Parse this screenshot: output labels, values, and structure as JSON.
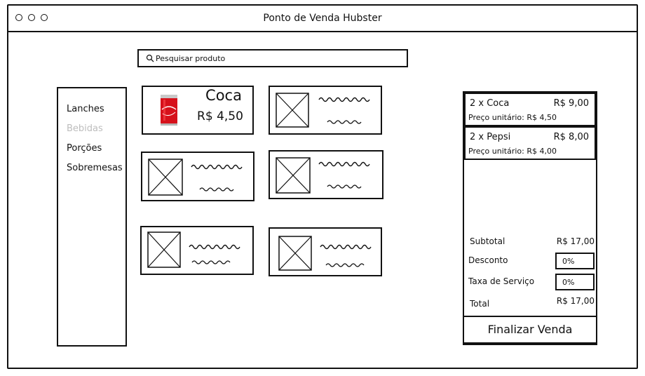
{
  "window": {
    "title": "Ponto de Venda Hubster"
  },
  "search": {
    "placeholder": "Pesquisar produto"
  },
  "sidebar": {
    "items": [
      {
        "label": "Lanches",
        "state": "normal"
      },
      {
        "label": "Bebidas",
        "state": "disabled"
      },
      {
        "label": "Porções",
        "state": "normal"
      },
      {
        "label": "Sobremesas",
        "state": "normal"
      }
    ]
  },
  "products": [
    {
      "name": "Coca",
      "price": "R$ 4,50",
      "image": "coca-cola-can"
    }
  ],
  "cart": {
    "items": [
      {
        "name": "2 x Coca",
        "total": "R$ 9,00",
        "unit": "Preço unitário: R$ 4,50"
      },
      {
        "name": "2 x Pepsi",
        "total": "R$ 8,00",
        "unit": "Preço unitário: R$ 4,00"
      }
    ],
    "subtotal_label": "Subtotal",
    "subtotal_value": "R$ 17,00",
    "discount_label": "Desconto",
    "discount_value": "0%",
    "service_label": "Taxa de Serviço",
    "service_value": "0%",
    "total_label": "Total",
    "total_value": "R$ 17,00",
    "finalize_label": "Finalizar Venda"
  }
}
